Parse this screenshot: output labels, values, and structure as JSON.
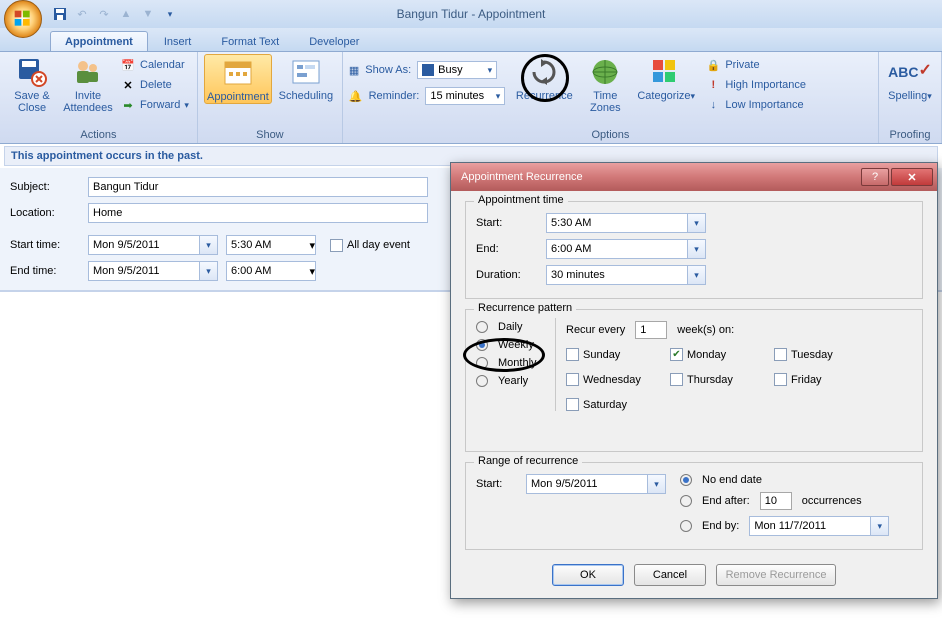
{
  "window": {
    "title": "Bangun Tidur - Appointment"
  },
  "tabs": {
    "appointment": "Appointment",
    "insert": "Insert",
    "format": "Format Text",
    "developer": "Developer"
  },
  "ribbon": {
    "actions": {
      "label": "Actions",
      "save_close": "Save & Close",
      "invite": "Invite Attendees",
      "calendar": "Calendar",
      "delete": "Delete",
      "forward": "Forward"
    },
    "show": {
      "label": "Show",
      "appointment": "Appointment",
      "scheduling": "Scheduling"
    },
    "options": {
      "label": "Options",
      "show_as": "Show As:",
      "busy": "Busy",
      "reminder": "Reminder:",
      "reminder_val": "15 minutes",
      "recurrence": "Recurrence",
      "timezones": "Time Zones",
      "categorize": "Categorize",
      "private": "Private",
      "high": "High Importance",
      "low": "Low Importance"
    },
    "proofing": {
      "label": "Proofing",
      "spelling": "Spelling"
    }
  },
  "banner": "This appointment occurs in the past.",
  "form": {
    "subject_lbl": "Subject:",
    "subject_val": "Bangun Tidur",
    "location_lbl": "Location:",
    "location_val": "Home",
    "start_lbl": "Start time:",
    "start_date": "Mon 9/5/2011",
    "start_time": "5:30 AM",
    "end_lbl": "End time:",
    "end_date": "Mon 9/5/2011",
    "end_time": "6:00 AM",
    "allday": "All day event"
  },
  "dialog": {
    "title": "Appointment Recurrence",
    "appt_time": {
      "legend": "Appointment time",
      "start_lbl": "Start:",
      "start_val": "5:30 AM",
      "end_lbl": "End:",
      "end_val": "6:00 AM",
      "dur_lbl": "Duration:",
      "dur_val": "30 minutes"
    },
    "pattern": {
      "legend": "Recurrence pattern",
      "daily": "Daily",
      "weekly": "Weekly",
      "monthly": "Monthly",
      "yearly": "Yearly",
      "recur_every": "Recur every",
      "weeks_on": "week(s) on:",
      "interval": "1",
      "days": {
        "sun": "Sunday",
        "mon": "Monday",
        "tue": "Tuesday",
        "wed": "Wednesday",
        "thu": "Thursday",
        "fri": "Friday",
        "sat": "Saturday"
      }
    },
    "range": {
      "legend": "Range of recurrence",
      "start_lbl": "Start:",
      "start_val": "Mon 9/5/2011",
      "no_end": "No end date",
      "end_after": "End after:",
      "occurrences": "occurrences",
      "occ_val": "10",
      "end_by": "End by:",
      "end_by_val": "Mon 11/7/2011"
    },
    "buttons": {
      "ok": "OK",
      "cancel": "Cancel",
      "remove": "Remove Recurrence"
    }
  }
}
